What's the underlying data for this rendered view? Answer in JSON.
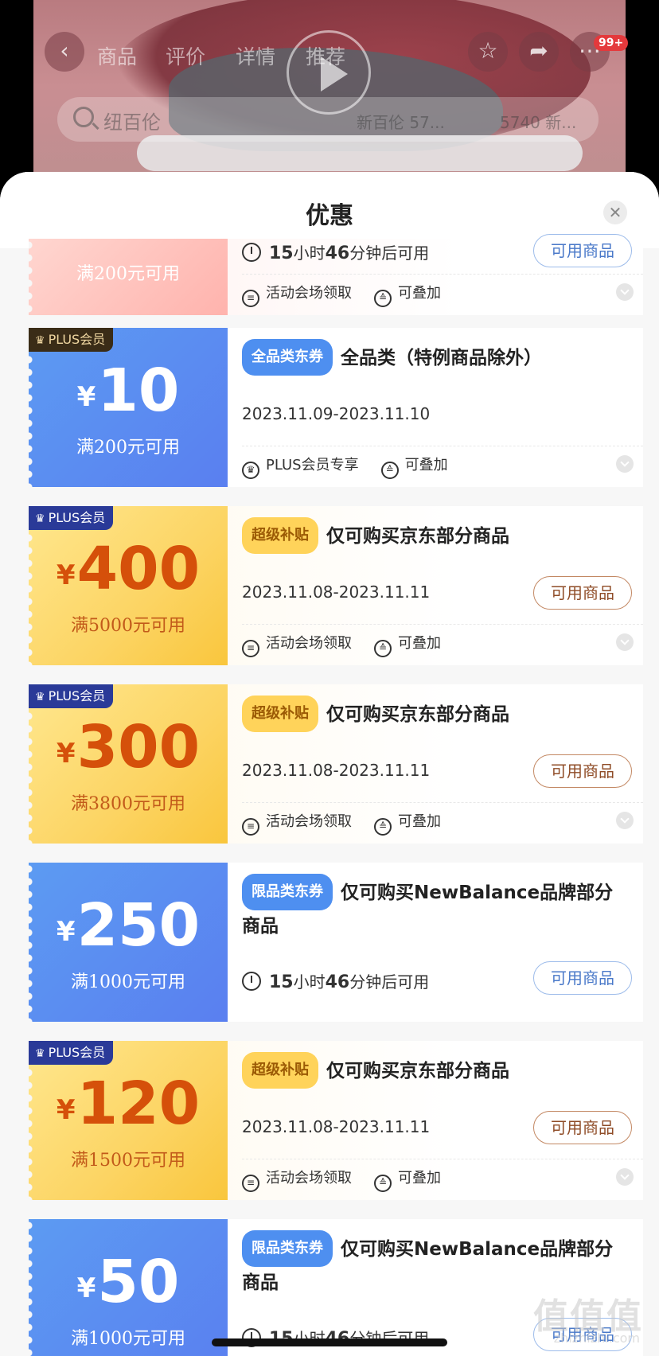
{
  "top_nav": {
    "back_icon": "chevron-left-icon",
    "tabs": [
      "商品",
      "评价",
      "详情",
      "推荐"
    ],
    "favorite_icon": "star-icon",
    "share_icon": "share-icon",
    "more_icon": "more-dots-icon",
    "message_badge": "99+",
    "search": {
      "keyword_primary": "纽百伦",
      "keyword_secondary": "新百伦 57...",
      "keyword_tertiary": "5740 新..."
    }
  },
  "sheet": {
    "title": "优惠",
    "close_icon": "close-icon"
  },
  "coupons": [
    {
      "type": "partial",
      "threshold": "满200元可用",
      "timer_num1": "15",
      "timer_txt1": "小时",
      "timer_num2": "46",
      "timer_txt2": "分钟后可用",
      "button": "可用商品",
      "foot_left": "活动会场领取",
      "foot_right": "可叠加"
    },
    {
      "badge": "PLUS会员",
      "yen": "¥",
      "amount": "10",
      "threshold": "满200元可用",
      "tag": "全品类东券",
      "title": "全品类（特例商品除外）",
      "date": "2023.11.09-2023.11.10",
      "foot_left": "PLUS会员专享",
      "foot_right": "可叠加"
    },
    {
      "badge": "PLUS会员",
      "yen": "¥",
      "amount": "400",
      "threshold": "满5000元可用",
      "tag": "超级补贴",
      "title": "仅可购买京东部分商品",
      "date": "2023.11.08-2023.11.11",
      "button": "可用商品",
      "foot_left": "活动会场领取",
      "foot_right": "可叠加"
    },
    {
      "badge": "PLUS会员",
      "yen": "¥",
      "amount": "300",
      "threshold": "满3800元可用",
      "tag": "超级补贴",
      "title": "仅可购买京东部分商品",
      "date": "2023.11.08-2023.11.11",
      "button": "可用商品",
      "foot_left": "活动会场领取",
      "foot_right": "可叠加"
    },
    {
      "yen": "¥",
      "amount": "250",
      "threshold": "满1000元可用",
      "tag": "限品类东券",
      "title": "仅可购买NewBalance品牌部分商品",
      "timer_num1": "15",
      "timer_txt1": "小时",
      "timer_num2": "46",
      "timer_txt2": "分钟后可用",
      "button": "可用商品"
    },
    {
      "badge": "PLUS会员",
      "yen": "¥",
      "amount": "120",
      "threshold": "满1500元可用",
      "tag": "超级补贴",
      "title": "仅可购买京东部分商品",
      "date": "2023.11.08-2023.11.11",
      "button": "可用商品",
      "foot_left": "活动会场领取",
      "foot_right": "可叠加"
    },
    {
      "yen": "¥",
      "amount": "50",
      "threshold": "满1000元可用",
      "tag": "限品类东券",
      "title": "仅可购买NewBalance品牌部分商品",
      "timer_num1": "15",
      "timer_txt1": "小时",
      "timer_num2": "46",
      "timer_txt2": "分钟后可用",
      "button": "可用商品"
    }
  ],
  "watermark": "值值值",
  "watermark_sub": "zhizhizhi.com",
  "colors": {
    "blue_coupon": "#5a7ff0",
    "gold_coupon": "#fcd463",
    "gold_amount": "#d5500a",
    "pink_coupon": "#ffb3ad"
  }
}
